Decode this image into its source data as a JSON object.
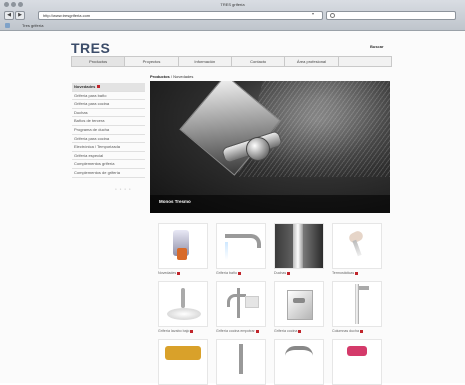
{
  "browser": {
    "window_title": "TRES grifería",
    "url": "http://www.tresgriferia.com",
    "search_placeholder": "",
    "back_symbol": "◀",
    "forward_symbol": "▶",
    "bookmark_label": "Tres grifería"
  },
  "site": {
    "logo": "TRES",
    "search_link": "Buscar"
  },
  "top_nav": [
    {
      "label": "Productos",
      "active": true
    },
    {
      "label": "Proyectos",
      "active": false
    },
    {
      "label": "Información",
      "active": false
    },
    {
      "label": "Contacto",
      "active": false
    },
    {
      "label": "Área profesional",
      "active": false
    },
    {
      "label": "",
      "active": false
    }
  ],
  "breadcrumb": {
    "section": "Productos",
    "current": "Novedades"
  },
  "sidebar": [
    {
      "label": "Novedades",
      "active": true,
      "badge": true
    },
    {
      "label": "Grifería para baño",
      "active": false
    },
    {
      "label": "Grifería para cocina",
      "active": false
    },
    {
      "label": "Duchas",
      "active": false
    },
    {
      "label": "Baños de tercera",
      "active": false
    },
    {
      "label": "Programa de ducha",
      "active": false
    },
    {
      "label": "Grifería para cocina",
      "active": false
    },
    {
      "label": "Electrónica / Temporizada",
      "active": false
    },
    {
      "label": "Grifería especial",
      "active": false
    },
    {
      "label": "Complementos grifería",
      "active": false
    },
    {
      "label": "Complementos de grifería",
      "active": false
    }
  ],
  "hero": {
    "title": "Monos Tresmo",
    "pager": "● ● ● ●"
  },
  "products": [
    {
      "label": "Novedades"
    },
    {
      "label": "Grifería baño"
    },
    {
      "label": "Duchas"
    },
    {
      "label": "Termostáticas"
    },
    {
      "label": "Grifería lavabo bajo"
    },
    {
      "label": "Grifería cocina empotrar"
    },
    {
      "label": "Grifería cocina"
    },
    {
      "label": "Columnas ducha"
    },
    {
      "label": ""
    },
    {
      "label": ""
    },
    {
      "label": ""
    },
    {
      "label": ""
    }
  ],
  "colors": {
    "accent_red": "#c0252b",
    "logo_blue": "#3c4d6a",
    "hero_dark": "#1a1a1a"
  }
}
